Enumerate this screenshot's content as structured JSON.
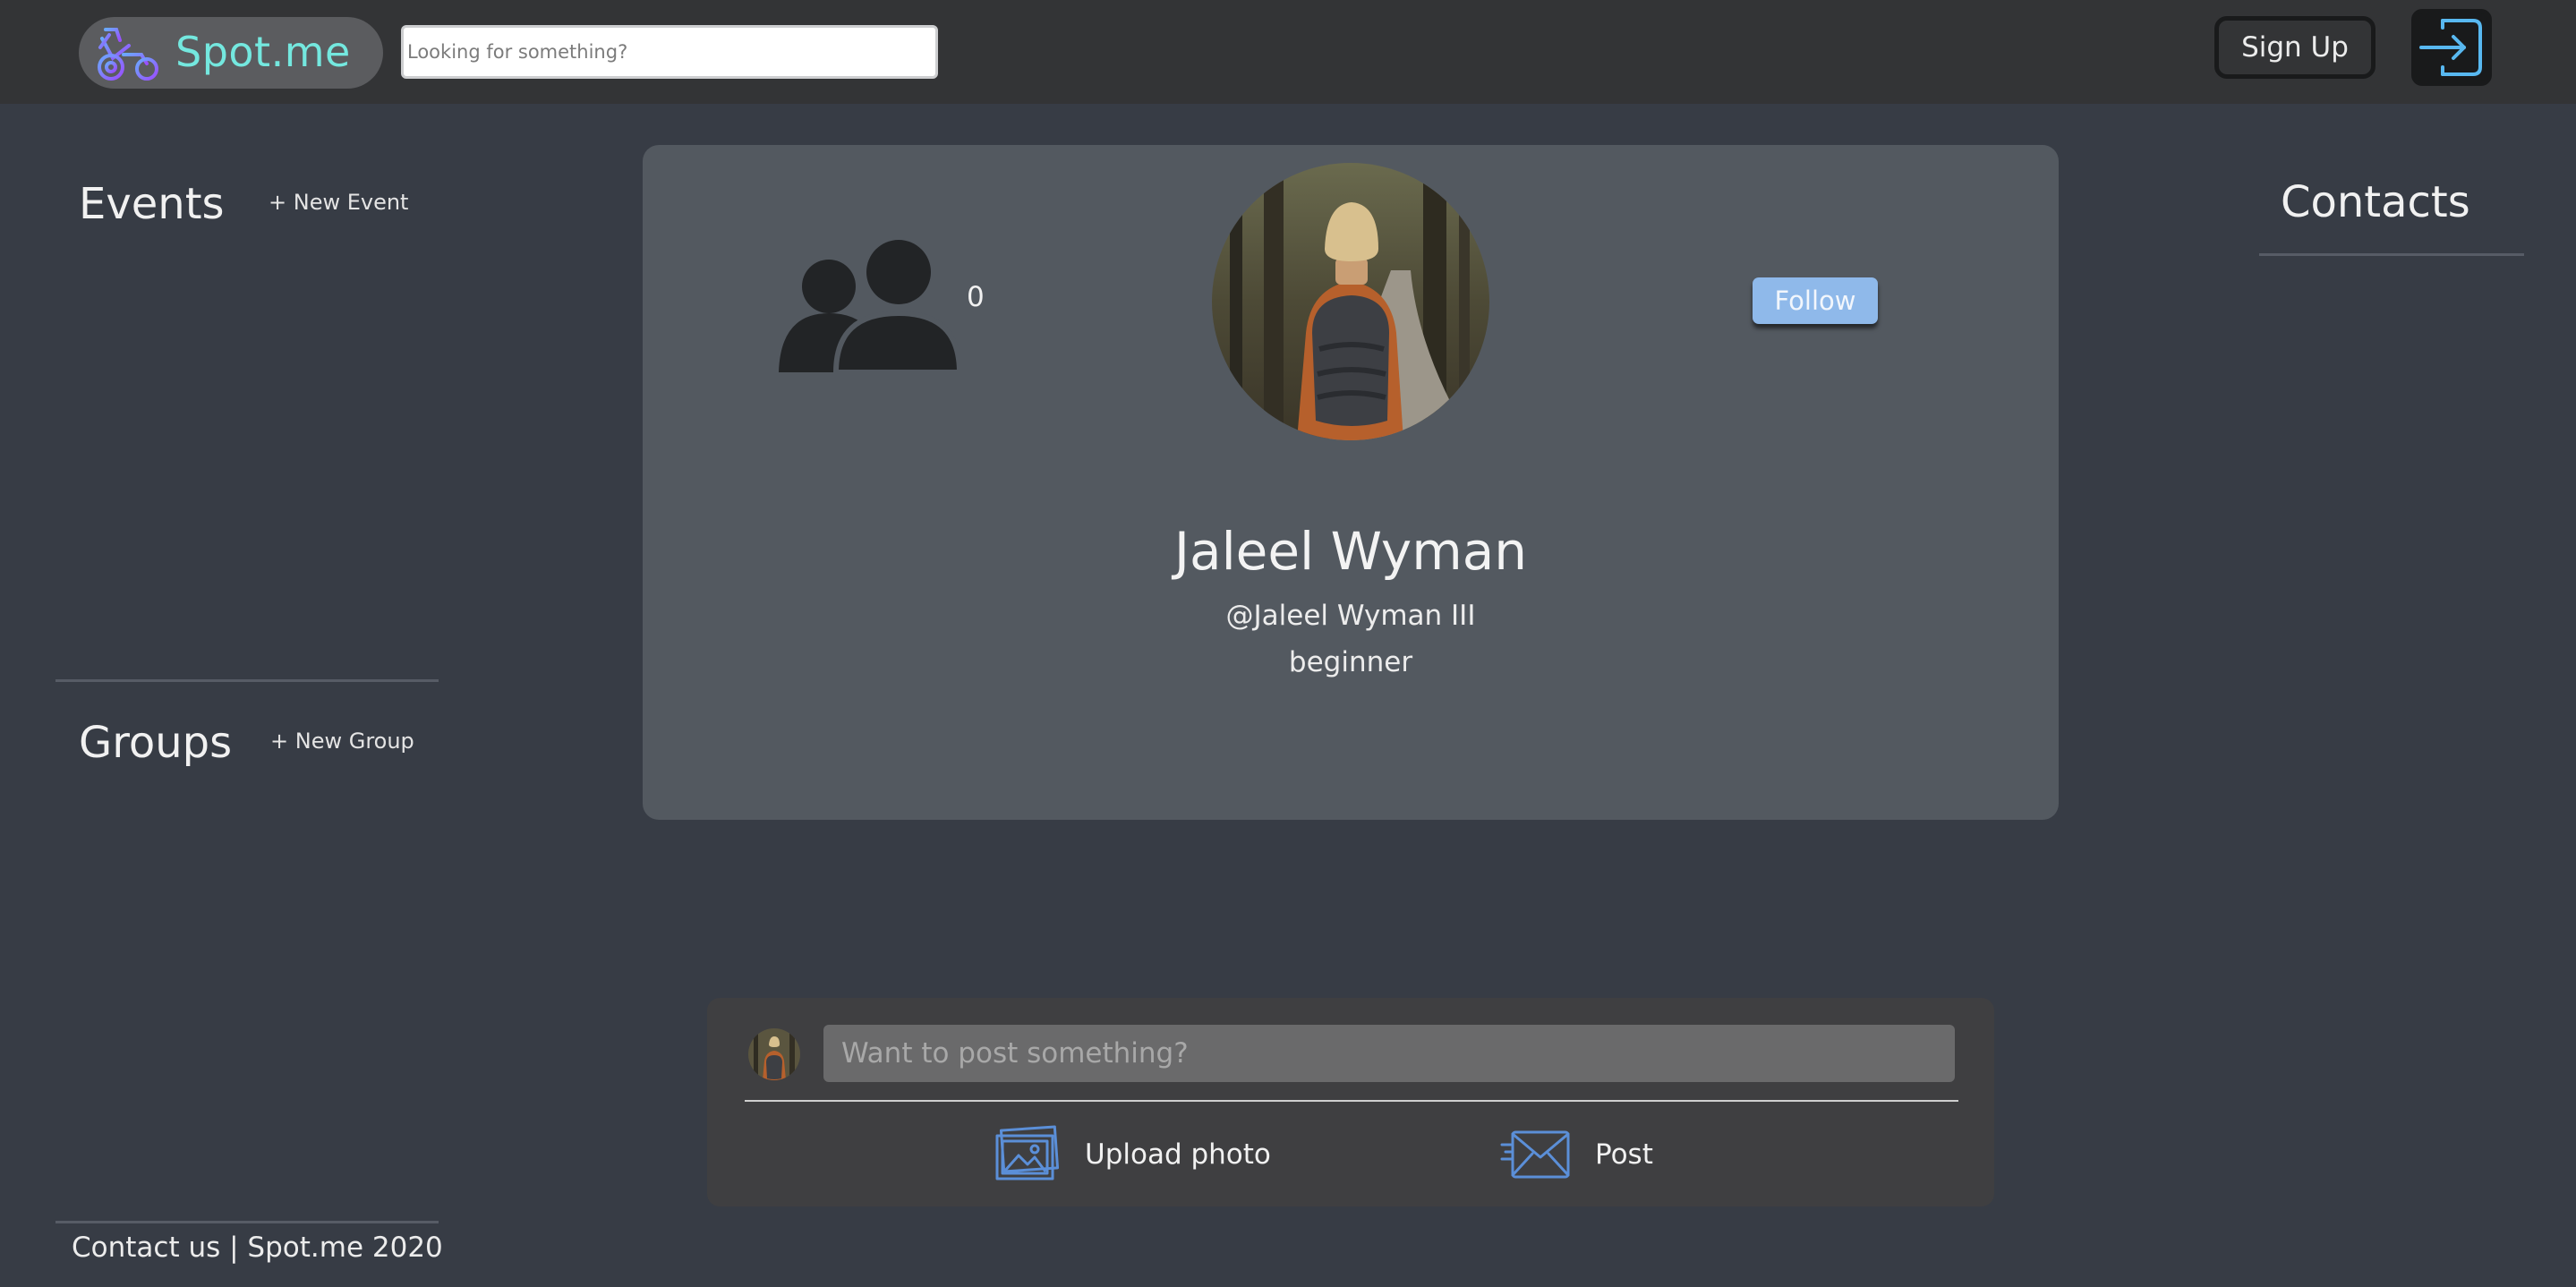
{
  "header": {
    "brand": "Spot.me",
    "search_placeholder": "Looking for something?",
    "signup_label": "Sign Up"
  },
  "sidebar": {
    "events_heading": "Events",
    "new_event_label": "+ New Event",
    "groups_heading": "Groups",
    "new_group_label": "+ New Group",
    "footer": "Contact us | Spot.me 2020"
  },
  "contacts": {
    "heading": "Contacts"
  },
  "profile": {
    "followers_count": "0",
    "follow_label": "Follow",
    "name": "Jaleel Wyman",
    "handle": "@Jaleel Wyman III",
    "level": "beginner"
  },
  "composer": {
    "placeholder": "Want to post something?",
    "upload_label": "Upload photo",
    "post_label": "Post"
  },
  "colors": {
    "page_background": "#373c45",
    "topbar_background": "#333436",
    "brand_teal": "#74e8df",
    "follow_blue": "#8fb9ea",
    "icon_blue": "#5b8fd8",
    "card_background": "#535960",
    "composer_background": "#3f3f41"
  },
  "icons": {
    "logo": "spot-logo-icon",
    "login": "login-arrow-icon",
    "followers": "users-icon",
    "upload": "photo-icon",
    "post": "mail-send-icon"
  }
}
